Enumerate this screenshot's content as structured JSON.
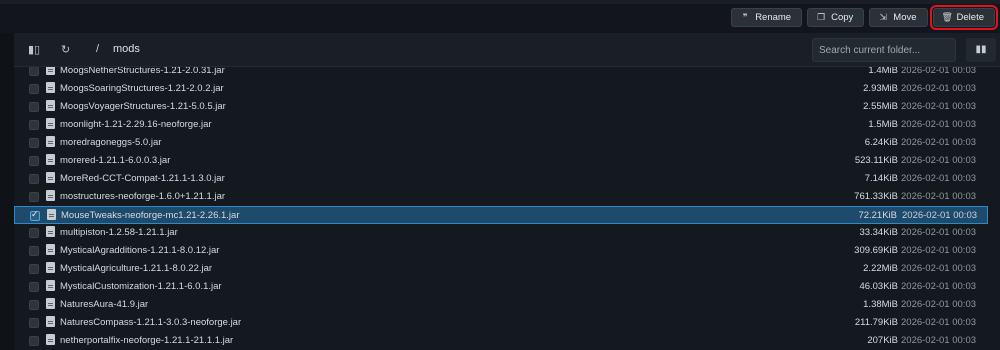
{
  "topbar": {
    "actions": [
      {
        "label": "Rename",
        "icon": "rename-icon"
      },
      {
        "label": "Copy",
        "icon": "copy-icon"
      },
      {
        "label": "Move",
        "icon": "move-icon"
      },
      {
        "label": "Delete",
        "icon": "trash-icon",
        "highlighted": true
      }
    ]
  },
  "toolbar": {
    "breadcrumb_sep": "/",
    "folder": "mods",
    "search_placeholder": "Search current folder..."
  },
  "files": [
    {
      "name": "MoogsNetherStructures-1.21-2.0.31.jar",
      "size": "1.4MiB",
      "date": "2026-02-01 00:03",
      "selected": false
    },
    {
      "name": "MoogsSoaringStructures-1.21-2.0.2.jar",
      "size": "2.93MiB",
      "date": "2026-02-01 00:03",
      "selected": false
    },
    {
      "name": "MoogsVoyagerStructures-1.21-5.0.5.jar",
      "size": "2.55MiB",
      "date": "2026-02-01 00:03",
      "selected": false
    },
    {
      "name": "moonlight-1.21-2.29.16-neoforge.jar",
      "size": "1.5MiB",
      "date": "2026-02-01 00:03",
      "selected": false
    },
    {
      "name": "moredragoneggs-5.0.jar",
      "size": "6.24KiB",
      "date": "2026-02-01 00:03",
      "selected": false
    },
    {
      "name": "morered-1.21.1-6.0.0.3.jar",
      "size": "523.11KiB",
      "date": "2026-02-01 00:03",
      "selected": false
    },
    {
      "name": "MoreRed-CCT-Compat-1.21.1-1.3.0.jar",
      "size": "7.14KiB",
      "date": "2026-02-01 00:03",
      "selected": false
    },
    {
      "name": "mostructures-neoforge-1.6.0+1.21.1.jar",
      "size": "761.33KiB",
      "date": "2026-02-01 00:03",
      "selected": false
    },
    {
      "name": "MouseTweaks-neoforge-mc1.21-2.26.1.jar",
      "size": "72.21KiB",
      "date": "2026-02-01 00:03",
      "selected": true
    },
    {
      "name": "multipiston-1.2.58-1.21.1.jar",
      "size": "33.34KiB",
      "date": "2026-02-01 00:03",
      "selected": false
    },
    {
      "name": "MysticalAgradditions-1.21.1-8.0.12.jar",
      "size": "309.69KiB",
      "date": "2026-02-01 00:03",
      "selected": false
    },
    {
      "name": "MysticalAgriculture-1.21.1-8.0.22.jar",
      "size": "2.22MiB",
      "date": "2026-02-01 00:03",
      "selected": false
    },
    {
      "name": "MysticalCustomization-1.21.1-6.0.1.jar",
      "size": "46.03KiB",
      "date": "2026-02-01 00:03",
      "selected": false
    },
    {
      "name": "NaturesAura-41.9.jar",
      "size": "1.38MiB",
      "date": "2026-02-01 00:03",
      "selected": false
    },
    {
      "name": "NaturesCompass-1.21.1-3.0.3-neoforge.jar",
      "size": "211.79KiB",
      "date": "2026-02-01 00:03",
      "selected": false
    },
    {
      "name": "netherportalfix-neoforge-1.21.1-21.1.1.jar",
      "size": "207KiB",
      "date": "2026-02-01 00:03",
      "selected": false
    }
  ],
  "colors": {
    "background": "#0f1318",
    "selected_row": "#1e4a6b",
    "selected_border": "#2f89c4",
    "delete_highlight": "#e0141e"
  }
}
